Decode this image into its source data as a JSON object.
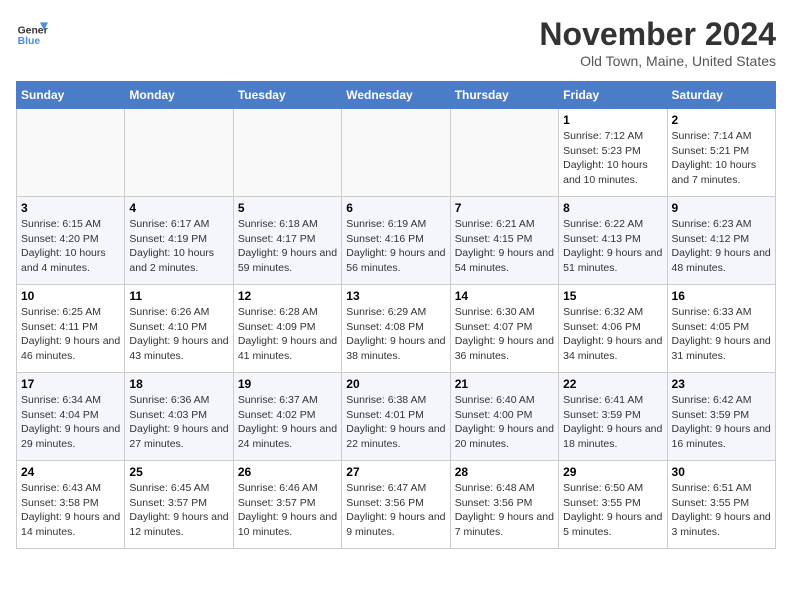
{
  "header": {
    "logo_line1": "General",
    "logo_line2": "Blue",
    "month": "November 2024",
    "location": "Old Town, Maine, United States"
  },
  "days_of_week": [
    "Sunday",
    "Monday",
    "Tuesday",
    "Wednesday",
    "Thursday",
    "Friday",
    "Saturday"
  ],
  "weeks": [
    [
      {
        "day": "",
        "info": ""
      },
      {
        "day": "",
        "info": ""
      },
      {
        "day": "",
        "info": ""
      },
      {
        "day": "",
        "info": ""
      },
      {
        "day": "",
        "info": ""
      },
      {
        "day": "1",
        "info": "Sunrise: 7:12 AM\nSunset: 5:23 PM\nDaylight: 10 hours and 10 minutes."
      },
      {
        "day": "2",
        "info": "Sunrise: 7:14 AM\nSunset: 5:21 PM\nDaylight: 10 hours and 7 minutes."
      }
    ],
    [
      {
        "day": "3",
        "info": "Sunrise: 6:15 AM\nSunset: 4:20 PM\nDaylight: 10 hours and 4 minutes."
      },
      {
        "day": "4",
        "info": "Sunrise: 6:17 AM\nSunset: 4:19 PM\nDaylight: 10 hours and 2 minutes."
      },
      {
        "day": "5",
        "info": "Sunrise: 6:18 AM\nSunset: 4:17 PM\nDaylight: 9 hours and 59 minutes."
      },
      {
        "day": "6",
        "info": "Sunrise: 6:19 AM\nSunset: 4:16 PM\nDaylight: 9 hours and 56 minutes."
      },
      {
        "day": "7",
        "info": "Sunrise: 6:21 AM\nSunset: 4:15 PM\nDaylight: 9 hours and 54 minutes."
      },
      {
        "day": "8",
        "info": "Sunrise: 6:22 AM\nSunset: 4:13 PM\nDaylight: 9 hours and 51 minutes."
      },
      {
        "day": "9",
        "info": "Sunrise: 6:23 AM\nSunset: 4:12 PM\nDaylight: 9 hours and 48 minutes."
      }
    ],
    [
      {
        "day": "10",
        "info": "Sunrise: 6:25 AM\nSunset: 4:11 PM\nDaylight: 9 hours and 46 minutes."
      },
      {
        "day": "11",
        "info": "Sunrise: 6:26 AM\nSunset: 4:10 PM\nDaylight: 9 hours and 43 minutes."
      },
      {
        "day": "12",
        "info": "Sunrise: 6:28 AM\nSunset: 4:09 PM\nDaylight: 9 hours and 41 minutes."
      },
      {
        "day": "13",
        "info": "Sunrise: 6:29 AM\nSunset: 4:08 PM\nDaylight: 9 hours and 38 minutes."
      },
      {
        "day": "14",
        "info": "Sunrise: 6:30 AM\nSunset: 4:07 PM\nDaylight: 9 hours and 36 minutes."
      },
      {
        "day": "15",
        "info": "Sunrise: 6:32 AM\nSunset: 4:06 PM\nDaylight: 9 hours and 34 minutes."
      },
      {
        "day": "16",
        "info": "Sunrise: 6:33 AM\nSunset: 4:05 PM\nDaylight: 9 hours and 31 minutes."
      }
    ],
    [
      {
        "day": "17",
        "info": "Sunrise: 6:34 AM\nSunset: 4:04 PM\nDaylight: 9 hours and 29 minutes."
      },
      {
        "day": "18",
        "info": "Sunrise: 6:36 AM\nSunset: 4:03 PM\nDaylight: 9 hours and 27 minutes."
      },
      {
        "day": "19",
        "info": "Sunrise: 6:37 AM\nSunset: 4:02 PM\nDaylight: 9 hours and 24 minutes."
      },
      {
        "day": "20",
        "info": "Sunrise: 6:38 AM\nSunset: 4:01 PM\nDaylight: 9 hours and 22 minutes."
      },
      {
        "day": "21",
        "info": "Sunrise: 6:40 AM\nSunset: 4:00 PM\nDaylight: 9 hours and 20 minutes."
      },
      {
        "day": "22",
        "info": "Sunrise: 6:41 AM\nSunset: 3:59 PM\nDaylight: 9 hours and 18 minutes."
      },
      {
        "day": "23",
        "info": "Sunrise: 6:42 AM\nSunset: 3:59 PM\nDaylight: 9 hours and 16 minutes."
      }
    ],
    [
      {
        "day": "24",
        "info": "Sunrise: 6:43 AM\nSunset: 3:58 PM\nDaylight: 9 hours and 14 minutes."
      },
      {
        "day": "25",
        "info": "Sunrise: 6:45 AM\nSunset: 3:57 PM\nDaylight: 9 hours and 12 minutes."
      },
      {
        "day": "26",
        "info": "Sunrise: 6:46 AM\nSunset: 3:57 PM\nDaylight: 9 hours and 10 minutes."
      },
      {
        "day": "27",
        "info": "Sunrise: 6:47 AM\nSunset: 3:56 PM\nDaylight: 9 hours and 9 minutes."
      },
      {
        "day": "28",
        "info": "Sunrise: 6:48 AM\nSunset: 3:56 PM\nDaylight: 9 hours and 7 minutes."
      },
      {
        "day": "29",
        "info": "Sunrise: 6:50 AM\nSunset: 3:55 PM\nDaylight: 9 hours and 5 minutes."
      },
      {
        "day": "30",
        "info": "Sunrise: 6:51 AM\nSunset: 3:55 PM\nDaylight: 9 hours and 3 minutes."
      }
    ]
  ]
}
